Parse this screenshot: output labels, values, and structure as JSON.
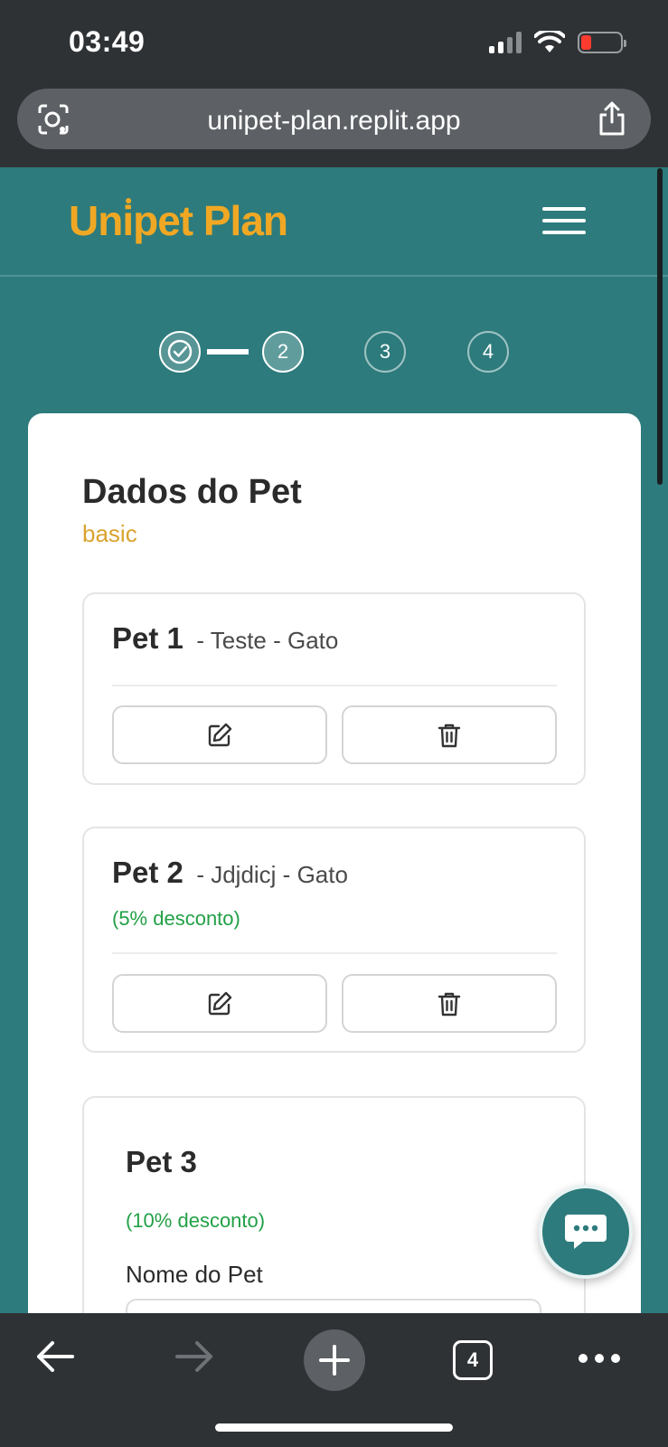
{
  "status_bar": {
    "time": "03:49"
  },
  "browser": {
    "url": "unipet-plan.replit.app",
    "tab_count": "4"
  },
  "header": {
    "logo": "Unipet Plan"
  },
  "stepper": {
    "steps": [
      "2",
      "3",
      "4"
    ]
  },
  "card": {
    "title": "Dados do Pet",
    "plan": "basic",
    "pets": [
      {
        "name": "Pet 1",
        "meta": "- Teste - Gato",
        "discount": ""
      },
      {
        "name": "Pet 2",
        "meta": "- Jdjdicj - Gato",
        "discount": "(5% desconto)"
      }
    ],
    "pet3": {
      "name": "Pet 3",
      "discount": "(10% desconto)",
      "field_label": "Nome do Pet",
      "field_value": ""
    }
  },
  "colors": {
    "teal": "#2d7b7c",
    "brand": "#f0a824",
    "discount": "#22a046",
    "plan": "#d9a32e"
  },
  "icons": [
    "camera-lens-icon",
    "share-icon",
    "menu-icon",
    "check-icon",
    "edit-icon",
    "trash-icon",
    "chat-icon",
    "back-arrow-icon",
    "forward-arrow-icon",
    "plus-icon",
    "more-icon"
  ]
}
